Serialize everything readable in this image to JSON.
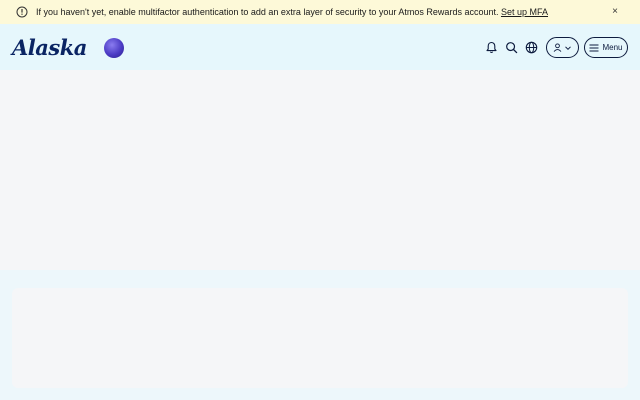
{
  "banner": {
    "message": "If you haven't yet, enable multifactor authentication to add an extra layer of security to your Atmos Rewards account.",
    "link_label": "Set up MFA",
    "close_label": "×",
    "icon": "info-icon"
  },
  "header": {
    "logo_text": "Alaska",
    "partner_badge_icon": "partner-logo-icon",
    "icons": [
      "bell-icon",
      "search-icon",
      "globe-icon"
    ],
    "account_icon": "user-icon",
    "menu_label": "Menu",
    "menu_icon": "hamburger-icon"
  },
  "colors": {
    "banner_bg": "#fdf9d8",
    "header_bg": "#e6f7fc",
    "brand_navy": "#0a2463",
    "content_bg": "#f5f6f8"
  }
}
